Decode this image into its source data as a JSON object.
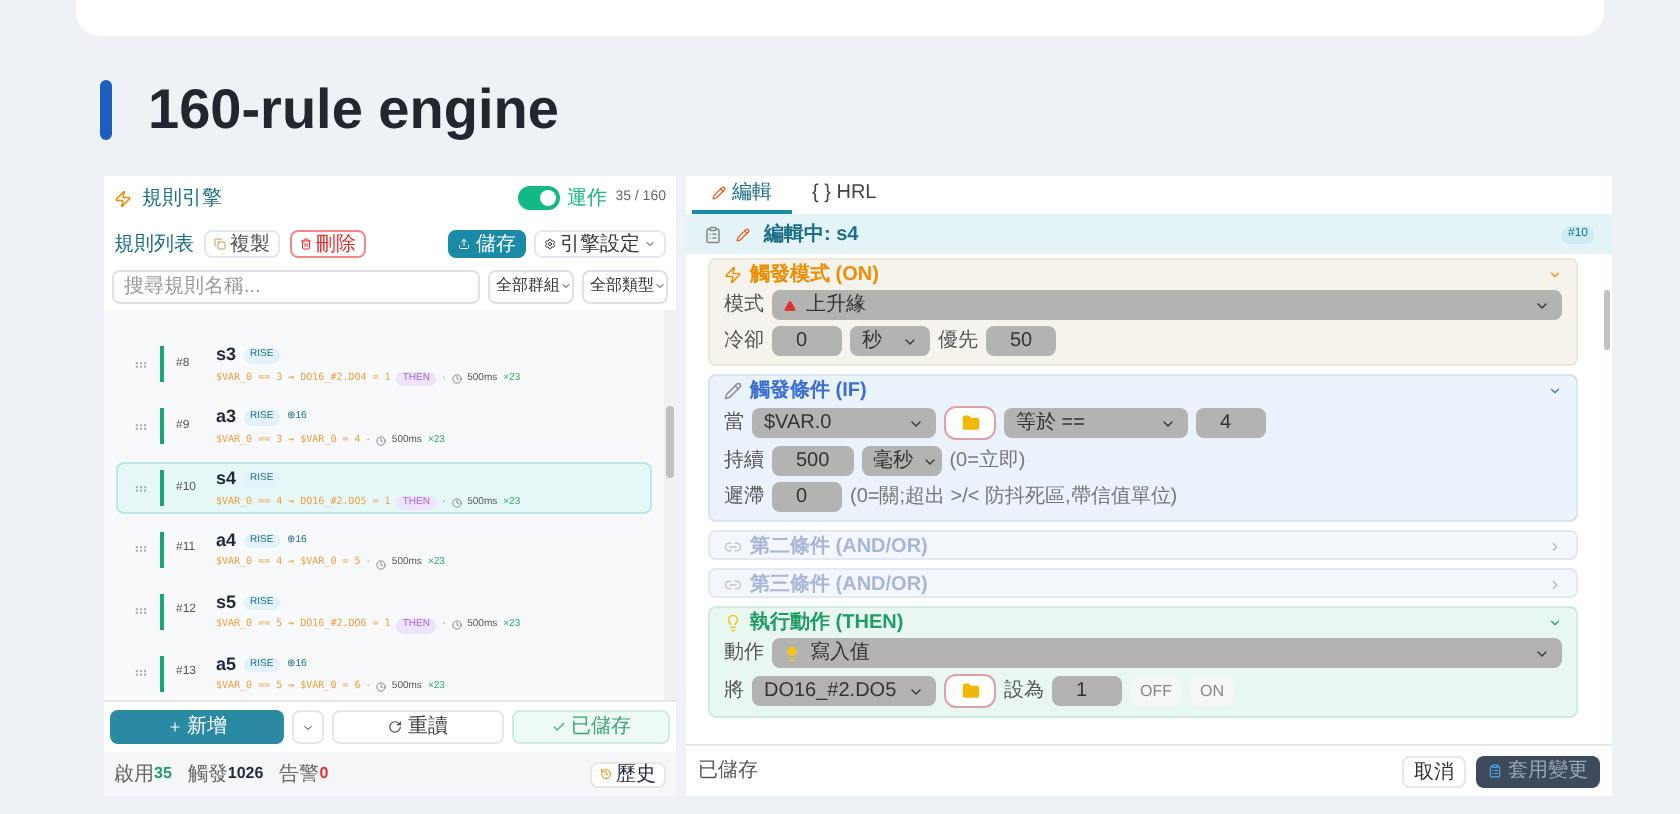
{
  "page_title": "160-rule engine",
  "left": {
    "title": "規則引擎",
    "engine": {
      "on": true,
      "label": "運作",
      "count": "35 / 160"
    },
    "list_label": "規則列表",
    "toolbar": [
      {
        "kind": "copy",
        "label": "複製"
      },
      {
        "kind": "delete",
        "label": "刪除"
      },
      {
        "kind": "save",
        "label": "儲存"
      },
      {
        "kind": "menu",
        "label": "引擎設定"
      }
    ],
    "search": {
      "placeholder": "搜尋規則名稱..."
    },
    "filters": [
      "全部群組",
      "全部類型"
    ],
    "rules": [
      {
        "index": "#8",
        "name": "s3",
        "trigger": "RISE",
        "expr": "$VAR_0 == 3 → DO16_#2.DO4 = 1",
        "then": "THEN",
        "sep": "·",
        "delay": "500ms",
        "count": "×23",
        "selected": false
      },
      {
        "index": "#9",
        "name": "a3",
        "trigger": "RISE",
        "tag": "⊕16",
        "expr": "$VAR_0 == 3 → $VAR_0 = 4",
        "sep": "·",
        "delay": "500ms",
        "count": "×23",
        "selected": false
      },
      {
        "index": "#10",
        "name": "s4",
        "trigger": "RISE",
        "expr": "$VAR_0 == 4 → DO16_#2.DO5 = 1",
        "then": "THEN",
        "sep": "·",
        "delay": "500ms",
        "count": "×23",
        "selected": true
      },
      {
        "index": "#11",
        "name": "a4",
        "trigger": "RISE",
        "tag": "⊕16",
        "expr": "$VAR_0 == 4 → $VAR_0 = 5",
        "sep": "·",
        "delay": "500ms",
        "count": "×23",
        "selected": false
      },
      {
        "index": "#12",
        "name": "s5",
        "trigger": "RISE",
        "expr": "$VAR_0 == 5 → DO16_#2.DO6 = 1",
        "then": "THEN",
        "sep": "·",
        "delay": "500ms",
        "count": "×23",
        "selected": false
      },
      {
        "index": "#13",
        "name": "a5",
        "trigger": "RISE",
        "tag": "⊕16",
        "expr": "$VAR_0 == 5 → $VAR_0 = 6",
        "sep": "·",
        "delay": "500ms",
        "count": "×23",
        "selected": false
      }
    ],
    "actions": [
      {
        "kind": "add",
        "label": "新增"
      },
      {
        "kind": "more"
      },
      {
        "kind": "reload",
        "label": "重讀"
      },
      {
        "kind": "saved",
        "label": "已儲存"
      }
    ],
    "stats": [
      {
        "label": "啟用",
        "value": "35",
        "color": "#22a06b"
      },
      {
        "label": "觸發",
        "value": "1026",
        "color": "#1f2937"
      },
      {
        "label": "告警",
        "value": "0",
        "color": "#e03131"
      }
    ],
    "history": "歷史"
  },
  "right": {
    "tabs": [
      {
        "label": "編輯",
        "selected": true
      },
      {
        "label": "{ } HRL",
        "selected": false
      }
    ],
    "editing": "編輯中: s4",
    "badge": "#10",
    "sections": [
      {
        "kind": "trigger",
        "title": "觸發模式 (ON)",
        "expanded": true,
        "rows": [
          {
            "fields": [
              {
                "kind": "label",
                "text": "模式"
              },
              {
                "kind": "select",
                "value": "上升緣"
              }
            ]
          },
          {
            "fields": [
              {
                "kind": "label",
                "text": "冷卻"
              },
              {
                "kind": "input",
                "value": "0"
              },
              {
                "kind": "select",
                "value": "秒"
              },
              {
                "kind": "label",
                "text": "優先"
              },
              {
                "kind": "input",
                "value": "50"
              }
            ]
          }
        ]
      },
      {
        "kind": "condition",
        "title": "觸發條件 (IF)",
        "expanded": true,
        "rows": [
          {
            "fields": [
              {
                "kind": "label",
                "text": "當"
              },
              {
                "kind": "select",
                "value": "$VAR.0"
              },
              {
                "kind": "folder"
              },
              {
                "kind": "select",
                "value": "等於 =="
              },
              {
                "kind": "input",
                "value": "4"
              }
            ]
          },
          {
            "fields": [
              {
                "kind": "label",
                "text": "持續"
              },
              {
                "kind": "input",
                "value": "500"
              },
              {
                "kind": "select",
                "value": "毫秒"
              }
            ],
            "hint": "(0=立即)"
          },
          {
            "fields": [
              {
                "kind": "label",
                "text": "遲滯"
              },
              {
                "kind": "input",
                "value": "0"
              }
            ],
            "hint": "(0=關;超出 >/< 防抖死區,帶信值單位)"
          }
        ]
      },
      {
        "kind": "extra",
        "title": "第二條件 (AND/OR)",
        "expanded": false
      },
      {
        "kind": "extra",
        "title": "第三條件 (AND/OR)",
        "expanded": false
      },
      {
        "kind": "action",
        "title": "執行動作 (THEN)",
        "expanded": true,
        "rows": [
          {
            "fields": [
              {
                "kind": "label",
                "text": "動作"
              },
              {
                "kind": "select",
                "value": "寫入值"
              }
            ]
          },
          {
            "fields": [
              {
                "kind": "label",
                "text": "將"
              },
              {
                "kind": "select",
                "value": "DO16_#2.DO5"
              },
              {
                "kind": "folder"
              },
              {
                "kind": "label",
                "text": "設為"
              },
              {
                "kind": "input",
                "value": "1"
              },
              {
                "kind": "chip",
                "text": "OFF"
              },
              {
                "kind": "chip",
                "text": "ON"
              }
            ]
          }
        ]
      }
    ],
    "status": "已儲存",
    "cancel": "取消",
    "apply": "套用變更"
  }
}
